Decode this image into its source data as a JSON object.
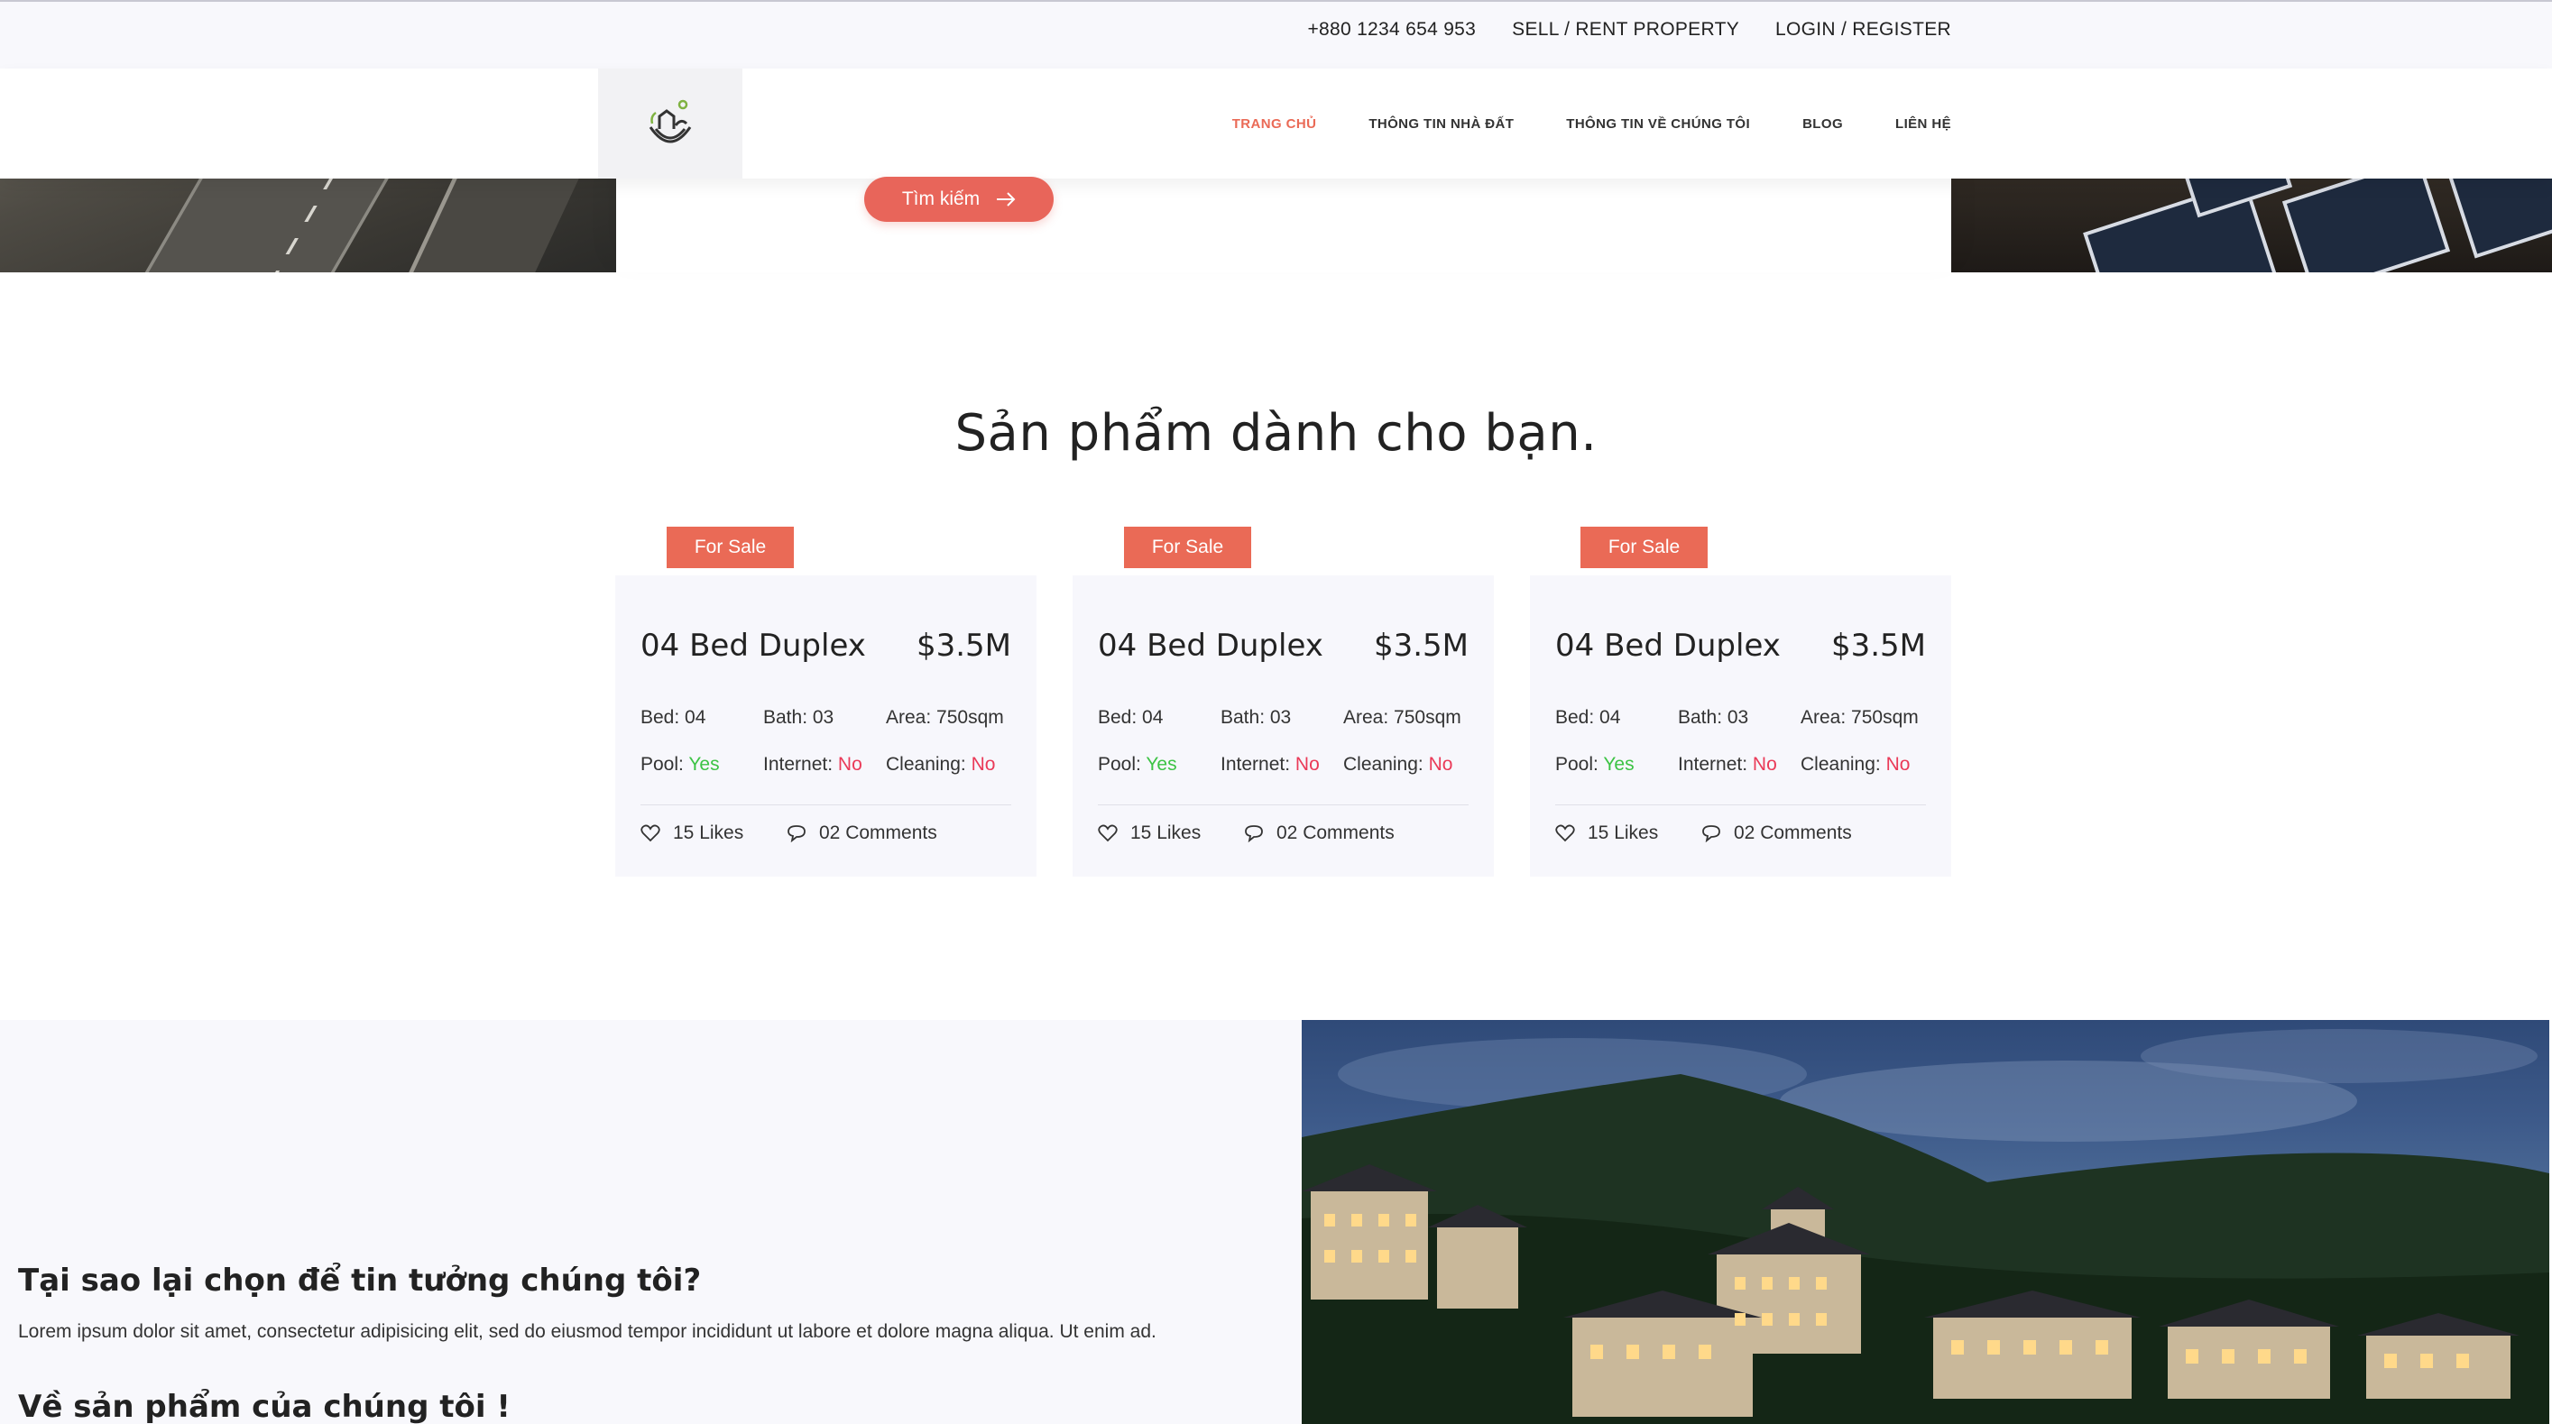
{
  "topbar": {
    "phone": "+880 1234 654 953",
    "sell_rent": "SELL / RENT PROPERTY",
    "login_register": "LOGIN / REGISTER"
  },
  "nav": {
    "items": [
      {
        "label": "TRANG CHỦ",
        "active": true
      },
      {
        "label": "THÔNG TIN NHÀ ĐẤT",
        "active": false
      },
      {
        "label": "THÔNG TIN VỀ CHÚNG TÔI",
        "active": false
      },
      {
        "label": "BLOG",
        "active": false
      },
      {
        "label": "LIÊN HỆ",
        "active": false
      }
    ]
  },
  "search": {
    "button_label": "Tìm kiếm"
  },
  "products": {
    "title": "Sản phẩm dành cho bạn.",
    "cards": [
      {
        "badge": "For Sale",
        "name": "04 Bed Duplex",
        "price": "$3.5M",
        "bed": "Bed: 04",
        "bath": "Bath: 03",
        "area": "Area: 750sqm",
        "pool_label": "Pool:",
        "pool_value": "Yes",
        "internet_label": "Internet:",
        "internet_value": "No",
        "cleaning_label": "Cleaning:",
        "cleaning_value": "No",
        "likes": "15 Likes",
        "comments": "02 Comments"
      },
      {
        "badge": "For Sale",
        "name": "04 Bed Duplex",
        "price": "$3.5M",
        "bed": "Bed: 04",
        "bath": "Bath: 03",
        "area": "Area: 750sqm",
        "pool_label": "Pool:",
        "pool_value": "Yes",
        "internet_label": "Internet:",
        "internet_value": "No",
        "cleaning_label": "Cleaning:",
        "cleaning_value": "No",
        "likes": "15 Likes",
        "comments": "02 Comments"
      },
      {
        "badge": "For Sale",
        "name": "04 Bed Duplex",
        "price": "$3.5M",
        "bed": "Bed: 04",
        "bath": "Bath: 03",
        "area": "Area: 750sqm",
        "pool_label": "Pool:",
        "pool_value": "Yes",
        "internet_label": "Internet:",
        "internet_value": "No",
        "cleaning_label": "Cleaning:",
        "cleaning_value": "No",
        "likes": "15 Likes",
        "comments": "02 Comments"
      }
    ]
  },
  "why": {
    "title": "Tại sao lại chọn để tin tưởng chúng tôi?",
    "text": "Lorem ipsum dolor sit amet, consectetur adipisicing elit, sed do eiusmod tempor incididunt ut labore et dolore magna aliqua. Ut enim ad.",
    "title2": "Về sản phẩm của chúng tôi !"
  },
  "colors": {
    "accent": "#ea6a56",
    "yes": "#3cc344",
    "no": "#ea3a58",
    "card_bg": "#f7f7fc"
  },
  "icons": {
    "logo": "house-hand-logo-icon",
    "search_arrow": "arrow-right-icon",
    "likes": "heart-icon",
    "comments": "comment-bubble-icon"
  }
}
